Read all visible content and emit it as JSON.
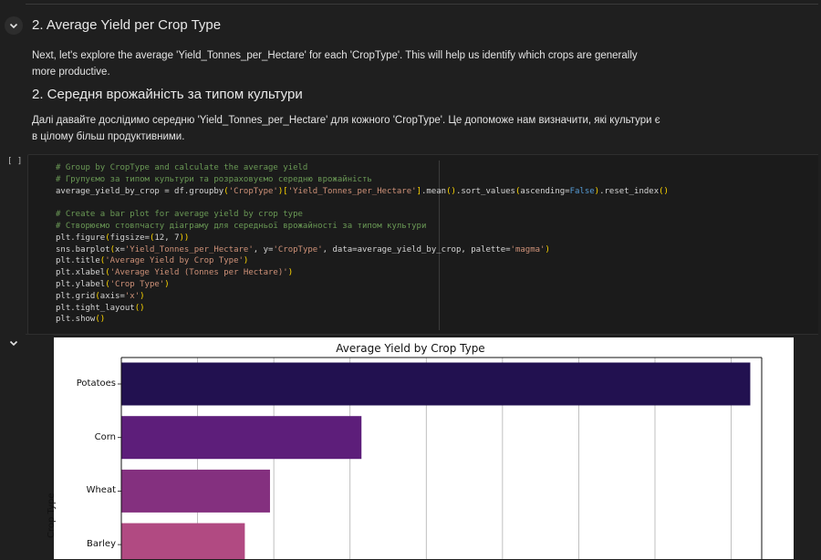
{
  "text_cell": {
    "heading_en": "2. Average Yield per Crop Type",
    "para_en": "Next, let's explore the average 'Yield_Tonnes_per_Hectare' for each 'CropType'. This will help us identify which crops are generally more productive.",
    "heading_uk": "2. Середня врожайність за типом культури",
    "para_uk": "Далі давайте дослідимо середню 'Yield_Tonnes_per_Hectare' для кожного 'CropType'. Це допоможе нам визначити, які культури є в цілому більш продуктивними."
  },
  "code_cell": {
    "run_indicator": "[ ]",
    "lines": [
      "# Group by CropType and calculate the average yield",
      "# Групуємо за типом культури та розраховуємо середню врожайність",
      "average_yield_by_crop = df.groupby('CropType')['Yield_Tonnes_per_Hectare'].mean().sort_values(ascending=False).reset_index()",
      "",
      "# Create a bar plot for average yield by crop type",
      "# Створюємо стовпчасту діаграму для середньої врожайності за типом культури",
      "plt.figure(figsize=(12, 7))",
      "sns.barplot(x='Yield_Tonnes_per_Hectare', y='CropType', data=average_yield_by_crop, palette='magma')",
      "plt.title('Average Yield by Crop Type')",
      "plt.xlabel('Average Yield (Tonnes per Hectare)')",
      "plt.ylabel('Crop Type')",
      "plt.grid(axis='x')",
      "plt.tight_layout()",
      "plt.show()"
    ]
  },
  "icons": {
    "cell_collapse": "chevron-down-icon",
    "output_collapse": "chevron-down-icon"
  },
  "chart_data": {
    "type": "bar",
    "orientation": "horizontal",
    "title": "Average Yield by Crop Type",
    "ylabel": "Crop Type",
    "categories": [
      "Potatoes",
      "Corn",
      "Wheat",
      "Barley"
    ],
    "values": [
      8.25,
      3.15,
      1.95,
      1.62
    ],
    "xlim": [
      0,
      8.4
    ],
    "grid": "x",
    "colors": [
      "#221150",
      "#5d1e7a",
      "#84307f",
      "#b14a82"
    ]
  }
}
